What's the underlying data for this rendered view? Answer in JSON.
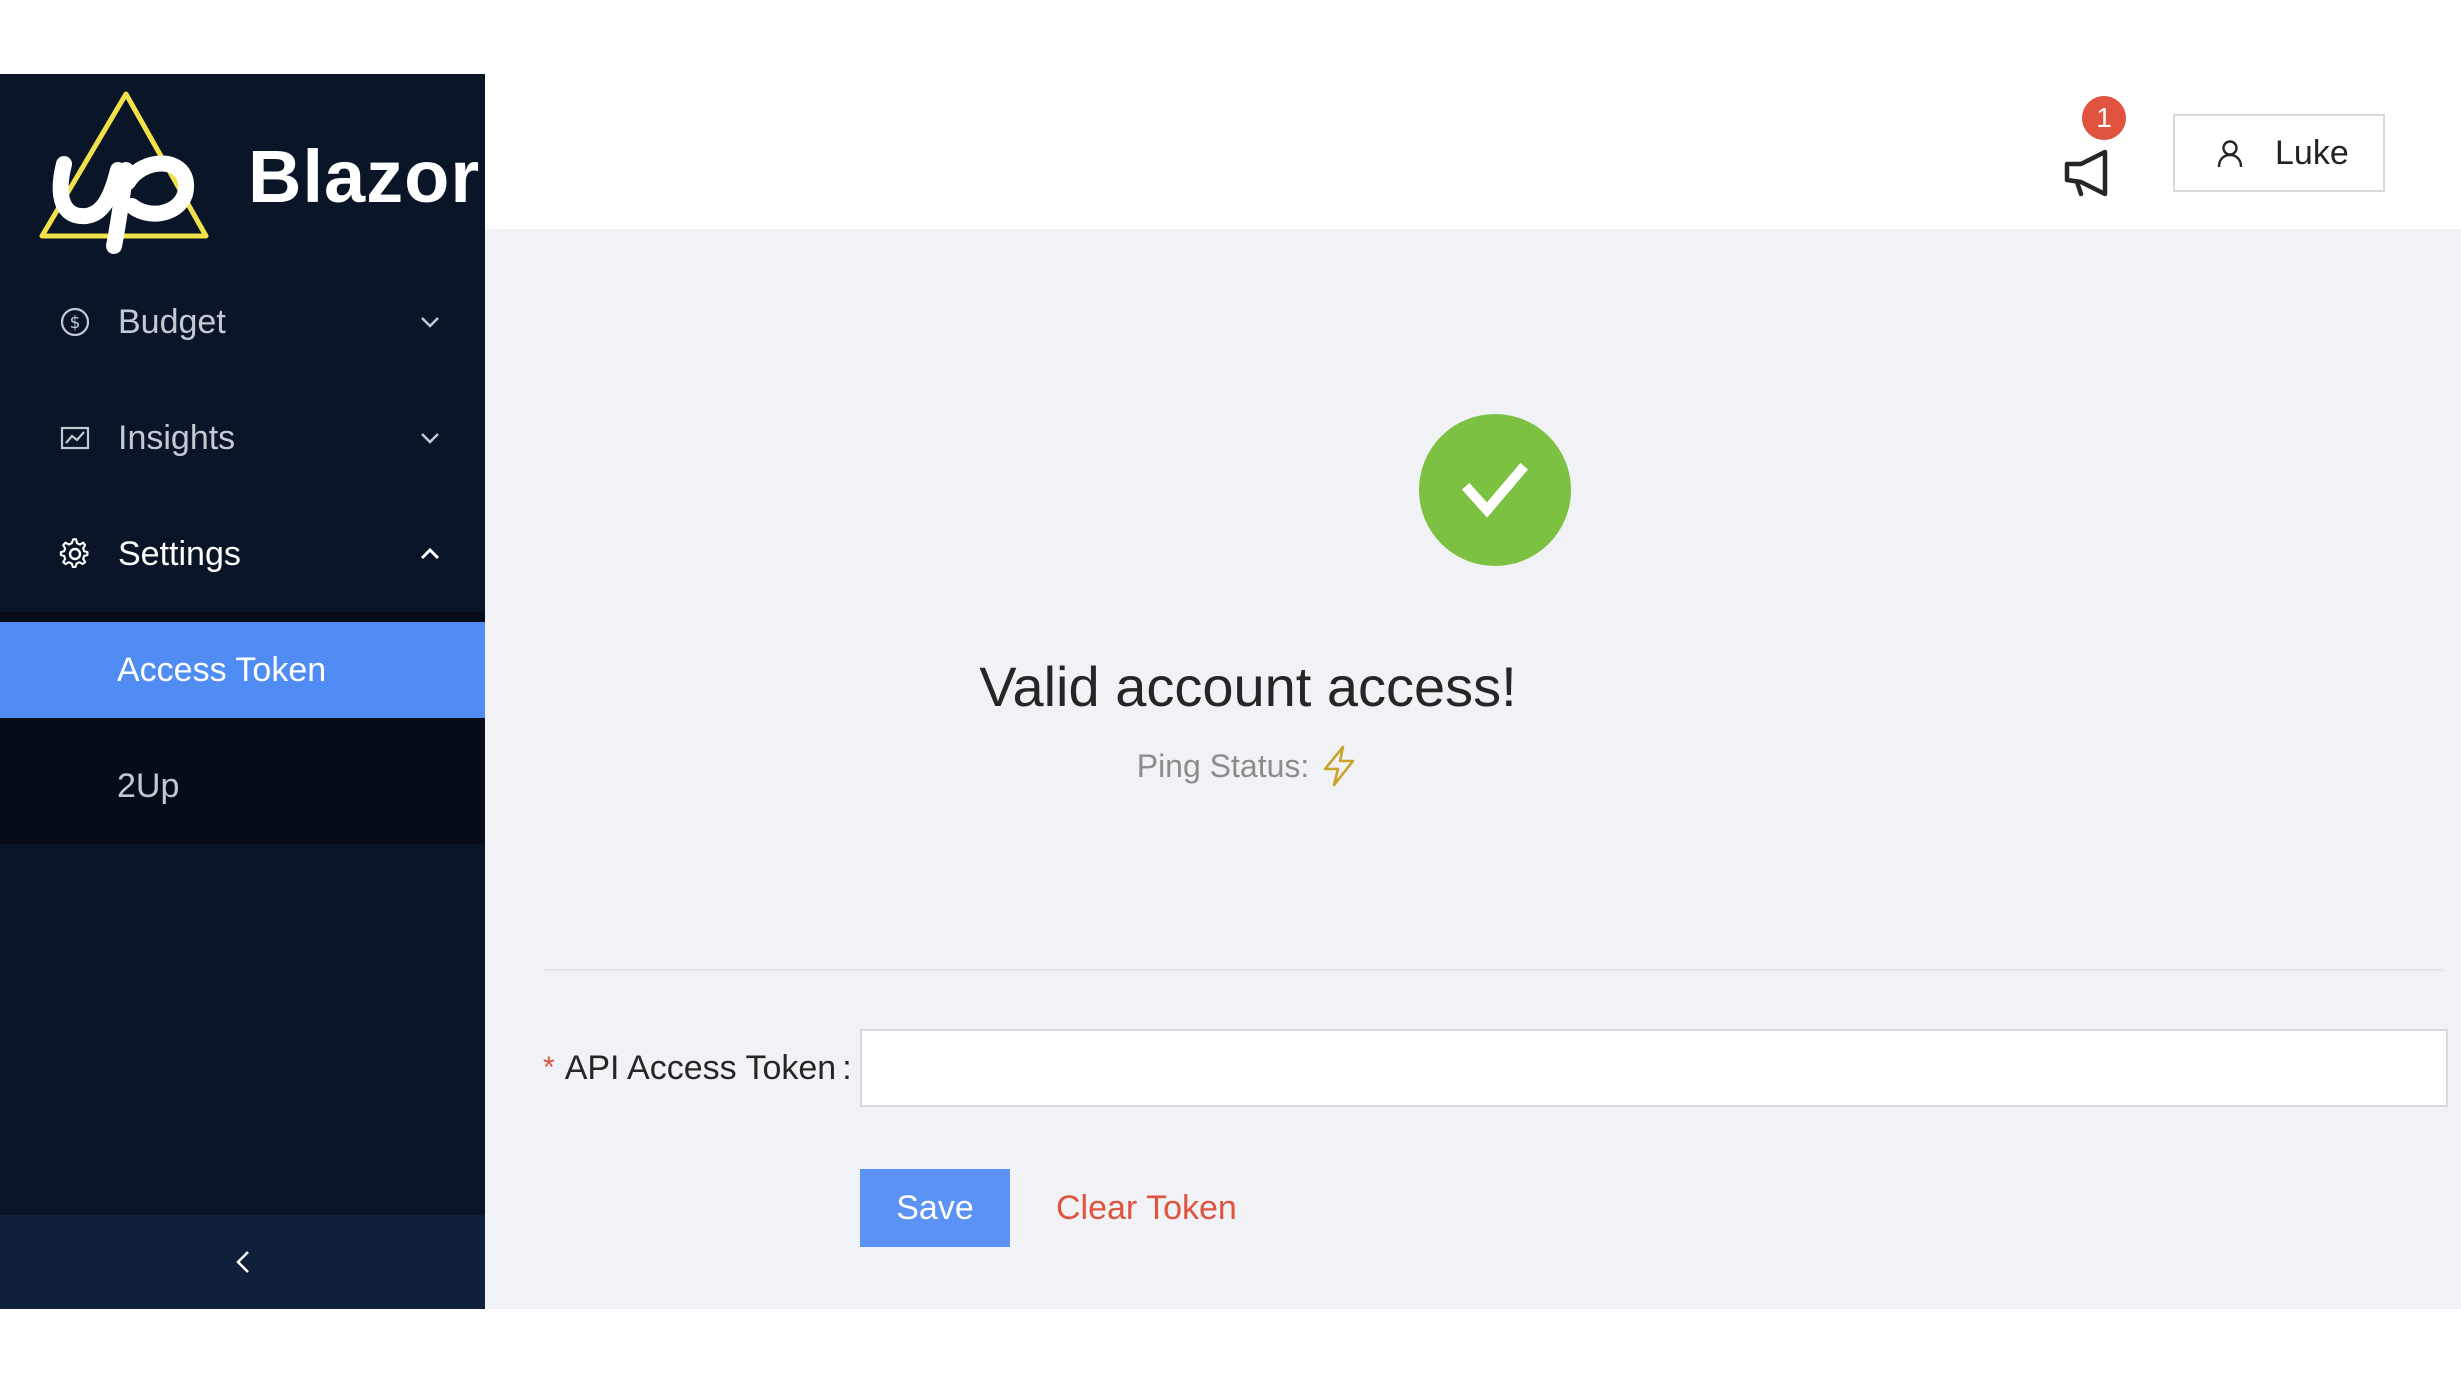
{
  "brand": {
    "name": "Blazor",
    "logo_icon": "up-logo-icon",
    "accent": "#f2e04a"
  },
  "sidebar": {
    "items": [
      {
        "label": "Budget",
        "icon": "dollar-circle-icon",
        "expanded": false
      },
      {
        "label": "Insights",
        "icon": "line-chart-icon",
        "expanded": false
      },
      {
        "label": "Settings",
        "icon": "gear-icon",
        "expanded": true,
        "children": [
          {
            "label": "Access Token",
            "active": true
          },
          {
            "label": "2Up",
            "active": false
          }
        ]
      }
    ],
    "collapse_icon": "chevron-left-icon",
    "bg": "#0a1628",
    "active_bg": "#4f8df5"
  },
  "header": {
    "notifications": {
      "count": "1",
      "icon": "megaphone-icon"
    },
    "user": {
      "name": "Luke",
      "icon": "user-icon"
    }
  },
  "result": {
    "status_icon": "check-circle-icon",
    "title": "Valid account access!",
    "subtitle": "Ping Status:",
    "ping_icon": "lightning-icon",
    "success_color": "#7dc142"
  },
  "form": {
    "label": "API Access Token",
    "colon": ":",
    "required_mark": "*",
    "value": "",
    "placeholder": ""
  },
  "actions": {
    "save_label": "Save",
    "clear_label": "Clear Token",
    "danger_color": "#e0533f"
  }
}
